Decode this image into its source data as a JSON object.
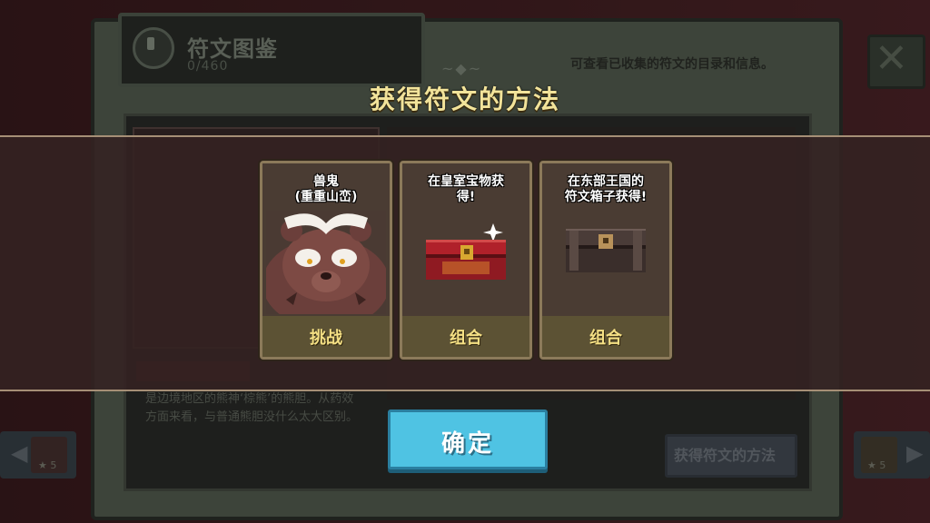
{
  "background": {
    "title": "符文图鉴",
    "count": "0/460",
    "hint": "可查看已收集的符文的目录和信息。",
    "description": "是边境地区的熊神‘棕熊’的熊胆。从药效方面来看，与普通熊胆没什么太大区别。",
    "method_button": "获得符文的方法",
    "nav_left_level": "★ 5",
    "nav_right_level": "★ 5"
  },
  "modal": {
    "title": "获得符文的方法",
    "cards": [
      {
        "source": "兽鬼\n(重重山峦)",
        "action": "挑战",
        "art": "bear-boss-icon"
      },
      {
        "source": "在皇室宝物获\n得!",
        "action": "组合",
        "art": "red-chest-icon"
      },
      {
        "source": "在东部王国的\n符文箱子获得!",
        "action": "组合",
        "art": "dark-chest-icon"
      }
    ],
    "confirm_label": "确定"
  },
  "colors": {
    "title_gold": "#f2e39a",
    "action_gold": "#f5e084",
    "confirm_blue": "#4fc3e3"
  }
}
